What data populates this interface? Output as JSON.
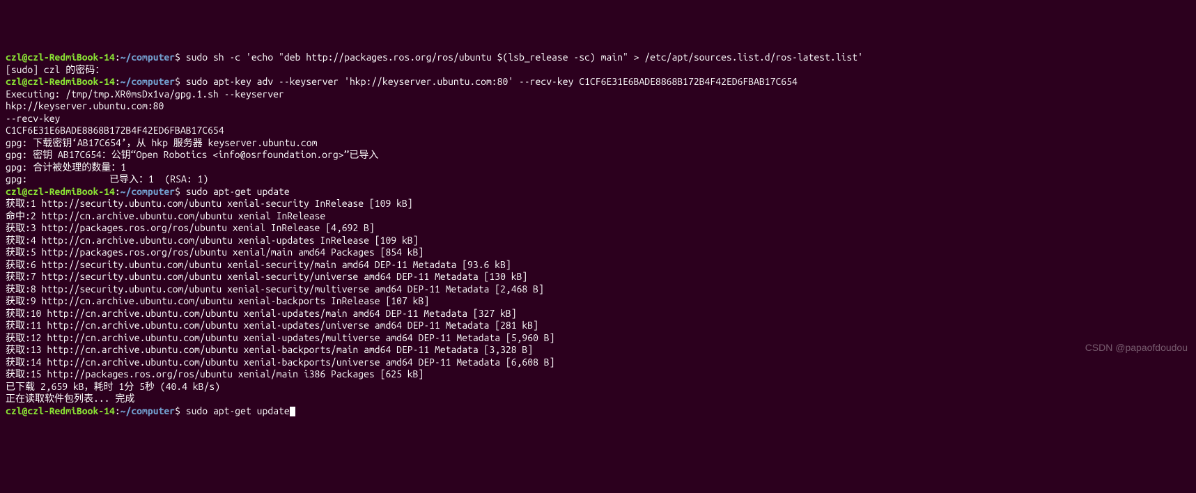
{
  "watermark": "CSDN @papaofdoudou",
  "prompt": {
    "user": "czl@czl-RedmiBook-14",
    "sep1": ":",
    "path": "~/computer",
    "sep2": "$ "
  },
  "lines": [
    {
      "type": "prompt",
      "cmd": "sudo sh -c 'echo \"deb http://packages.ros.org/ros/ubuntu $(lsb_release -sc) main\" > /etc/apt/sources.list.d/ros-latest.list'"
    },
    {
      "type": "out",
      "text": "[sudo] czl 的密码："
    },
    {
      "type": "prompt",
      "cmd": "sudo apt-key adv --keyserver 'hkp://keyserver.ubuntu.com:80' --recv-key C1CF6E31E6BADE8868B172B4F42ED6FBAB17C654"
    },
    {
      "type": "out",
      "text": "Executing: /tmp/tmp.XR0msDx1va/gpg.1.sh --keyserver"
    },
    {
      "type": "out",
      "text": "hkp://keyserver.ubuntu.com:80"
    },
    {
      "type": "out",
      "text": "--recv-key"
    },
    {
      "type": "out",
      "text": "C1CF6E31E6BADE8868B172B4F42ED6FBAB17C654"
    },
    {
      "type": "out",
      "text": "gpg: 下载密钥‘AB17C654’，从 hkp 服务器 keyserver.ubuntu.com"
    },
    {
      "type": "out",
      "text": "gpg: 密钥 AB17C654：公钥“Open Robotics <info@osrfoundation.org>”已导入"
    },
    {
      "type": "out",
      "text": "gpg: 合计被处理的数量：1"
    },
    {
      "type": "out",
      "text": "gpg:               已导入：1  (RSA: 1)"
    },
    {
      "type": "prompt",
      "cmd": "sudo apt-get update"
    },
    {
      "type": "out",
      "text": "获取:1 http://security.ubuntu.com/ubuntu xenial-security InRelease [109 kB]"
    },
    {
      "type": "out",
      "text": "命中:2 http://cn.archive.ubuntu.com/ubuntu xenial InRelease"
    },
    {
      "type": "out",
      "text": "获取:3 http://packages.ros.org/ros/ubuntu xenial InRelease [4,692 B]"
    },
    {
      "type": "out",
      "text": "获取:4 http://cn.archive.ubuntu.com/ubuntu xenial-updates InRelease [109 kB]"
    },
    {
      "type": "out",
      "text": "获取:5 http://packages.ros.org/ros/ubuntu xenial/main amd64 Packages [854 kB]"
    },
    {
      "type": "out",
      "text": "获取:6 http://security.ubuntu.com/ubuntu xenial-security/main amd64 DEP-11 Metadata [93.6 kB]"
    },
    {
      "type": "out",
      "text": "获取:7 http://security.ubuntu.com/ubuntu xenial-security/universe amd64 DEP-11 Metadata [130 kB]"
    },
    {
      "type": "out",
      "text": "获取:8 http://security.ubuntu.com/ubuntu xenial-security/multiverse amd64 DEP-11 Metadata [2,468 B]"
    },
    {
      "type": "out",
      "text": "获取:9 http://cn.archive.ubuntu.com/ubuntu xenial-backports InRelease [107 kB]"
    },
    {
      "type": "out",
      "text": "获取:10 http://cn.archive.ubuntu.com/ubuntu xenial-updates/main amd64 DEP-11 Metadata [327 kB]"
    },
    {
      "type": "out",
      "text": "获取:11 http://cn.archive.ubuntu.com/ubuntu xenial-updates/universe amd64 DEP-11 Metadata [281 kB]"
    },
    {
      "type": "out",
      "text": "获取:12 http://cn.archive.ubuntu.com/ubuntu xenial-updates/multiverse amd64 DEP-11 Metadata [5,960 B]"
    },
    {
      "type": "out",
      "text": "获取:13 http://cn.archive.ubuntu.com/ubuntu xenial-backports/main amd64 DEP-11 Metadata [3,328 B]"
    },
    {
      "type": "out",
      "text": "获取:14 http://cn.archive.ubuntu.com/ubuntu xenial-backports/universe amd64 DEP-11 Metadata [6,608 B]"
    },
    {
      "type": "out",
      "text": "获取:15 http://packages.ros.org/ros/ubuntu xenial/main i386 Packages [625 kB]"
    },
    {
      "type": "out",
      "text": "已下载 2,659 kB，耗时 1分 5秒 (40.4 kB/s)"
    },
    {
      "type": "out",
      "text": "正在读取软件包列表... 完成"
    },
    {
      "type": "prompt",
      "cmd": "sudo apt-get update",
      "cursor": true
    }
  ]
}
